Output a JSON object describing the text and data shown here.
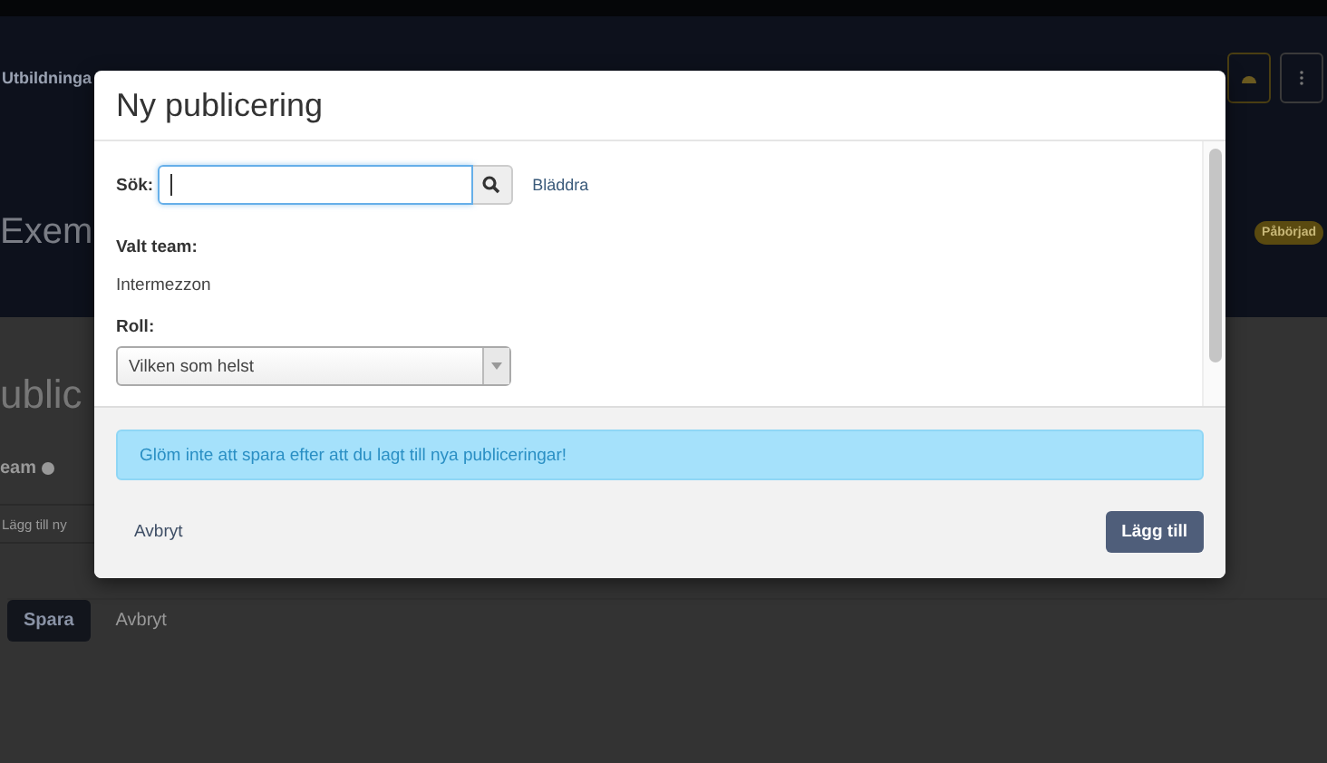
{
  "background_page": {
    "nav_label": "Utbildninga",
    "page_title": "Exem",
    "status_badge": "Påbörjad",
    "section_title": "ublic",
    "field_label": "eam",
    "field_placeholder": "Lägg till ny",
    "buttons": [
      {
        "label": "Spara",
        "kind": "primary"
      },
      {
        "label": "Avbryt",
        "kind": "link"
      }
    ]
  },
  "dialog": {
    "title": "Ny publicering",
    "search": {
      "label": "Sök:",
      "focused": true
    },
    "browse_link": "Bläddra",
    "selected_team": {
      "label": "Valt team:",
      "value": "Intermezzon"
    },
    "role": {
      "label": "Roll:",
      "value": "Vilken som helst"
    },
    "alert": "Glöm inte att spara efter att du lagt till nya publiceringar!",
    "cancel": "Avbryt",
    "submit": "Lägg till"
  }
}
